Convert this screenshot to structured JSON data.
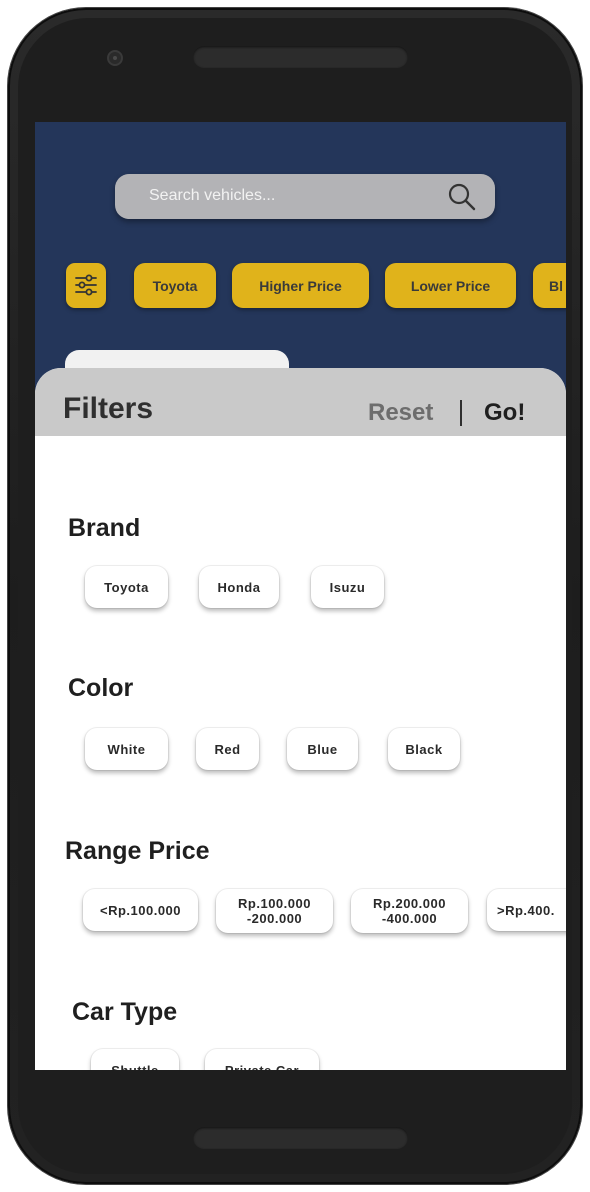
{
  "search": {
    "placeholder": "Search vehicles..."
  },
  "quick_filters": [
    "Toyota",
    "Higher Price",
    "Lower Price",
    "Bl"
  ],
  "sheet": {
    "title": "Filters",
    "reset_label": "Reset",
    "separator": "|",
    "go_label": "Go!"
  },
  "sections": {
    "brand": {
      "title": "Brand",
      "options": [
        "Toyota",
        "Honda",
        "Isuzu"
      ]
    },
    "color": {
      "title": "Color",
      "options": [
        "White",
        "Red",
        "Blue",
        "Black"
      ]
    },
    "range_price": {
      "title": "Range Price",
      "options": [
        "<Rp.100.000",
        "Rp.100.000\n-200.000",
        "Rp.200.000\n-400.000",
        ">Rp.400."
      ]
    },
    "car_type": {
      "title": "Car Type",
      "options": [
        "Shuttle",
        "Private Car"
      ]
    }
  },
  "colors": {
    "screen_bg": "#24365a",
    "accent": "#e0b31b",
    "header_gray": "#c9c9c9"
  }
}
